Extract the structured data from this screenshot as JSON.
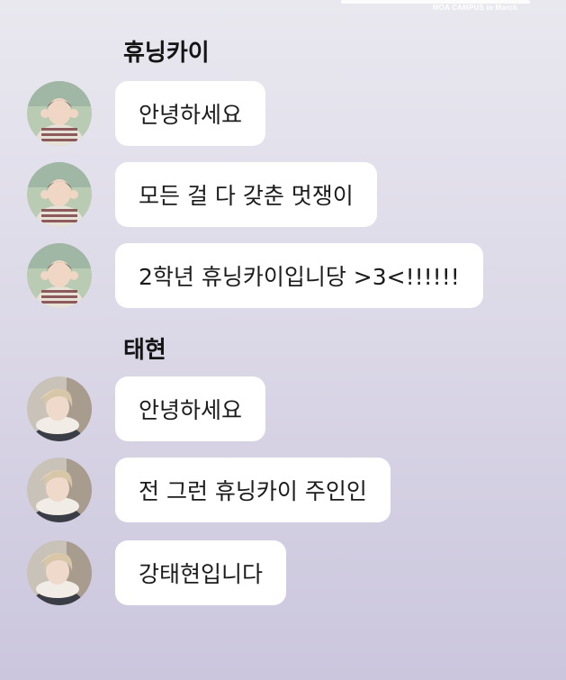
{
  "header": {
    "caption": "MOA CAMPUS in March"
  },
  "groups": [
    {
      "sender": "휴닝카이",
      "messages": [
        {
          "text": "안녕하세요"
        },
        {
          "text": "모든 걸 다 갖춘 멋쟁이"
        },
        {
          "text": "2학년 휴닝카이입니당 >3<!!!!!!"
        }
      ]
    },
    {
      "sender": "태현",
      "messages": [
        {
          "text": "안녕하세요"
        },
        {
          "text": "전 그런 휴닝카이 주인인"
        },
        {
          "text": "강태현입니다"
        }
      ]
    }
  ]
}
